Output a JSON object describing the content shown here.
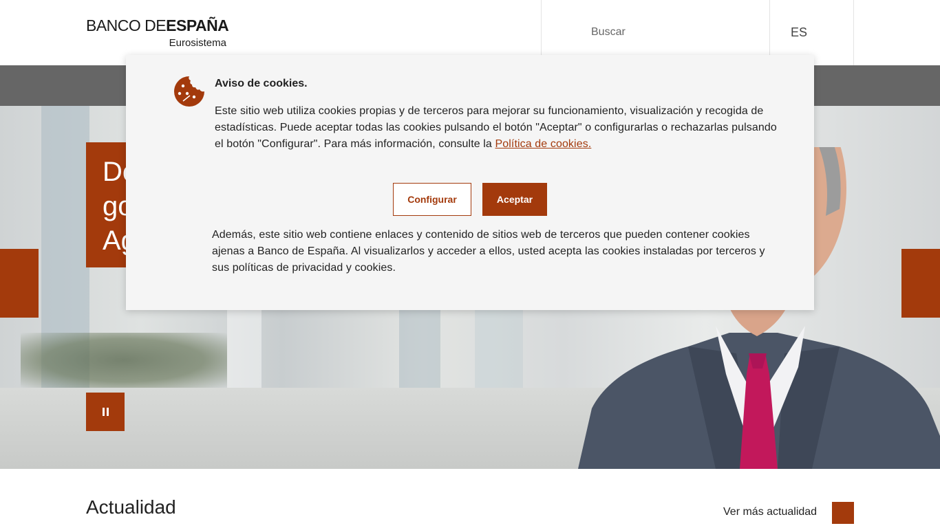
{
  "header": {
    "logo_part1": "BANCO DE",
    "logo_part2": "ESPAÑA",
    "logo_sub": "Eurosistema",
    "search_placeholder": "Buscar",
    "language": "ES"
  },
  "hero": {
    "title": "De\ngo\nAg"
  },
  "cookie_notice": {
    "title": "Aviso de cookies.",
    "text_main": "Este sitio web utiliza cookies propias y de terceros para mejorar su funcionamiento, visualización y recogida de estadísticas. Puede aceptar todas las cookies pulsando el botón \"Aceptar\" o configurarlas o rechazarlas pulsando el botón \"Configurar\". Para más información, consulte la ",
    "link_text": "Política de cookies.",
    "configure_label": "Configurar",
    "accept_label": "Aceptar",
    "text_secondary": "Además, este sitio web contiene enlaces y contenido de sitios web de terceros que pueden contener cookies ajenas a Banco de España. Al visualizarlos y acceder a ellos, usted acepta las cookies instaladas por terceros y sus políticas de privacidad y cookies."
  },
  "news": {
    "heading": "Actualidad",
    "more_label": "Ver más actualidad"
  },
  "colors": {
    "brand": "#a33a0c",
    "nav": "#666666",
    "modal_bg": "#f5f5f5"
  }
}
